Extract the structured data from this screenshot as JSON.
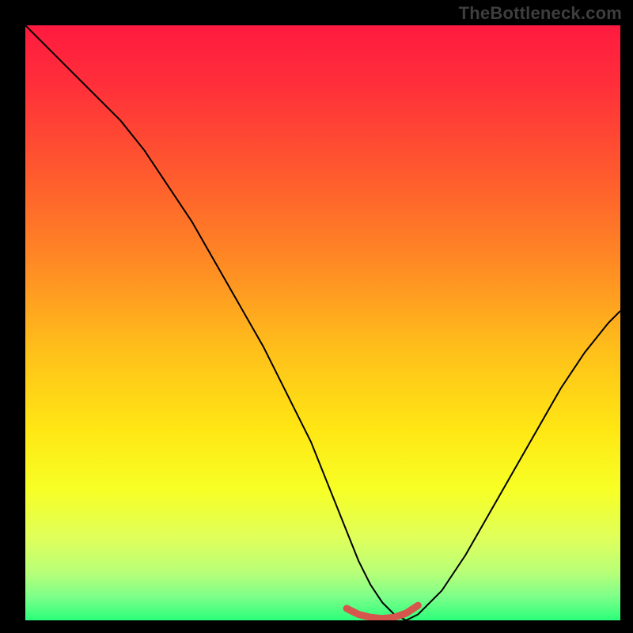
{
  "watermark": "TheBottleneck.com",
  "chart_data": {
    "type": "line",
    "title": "",
    "xlabel": "",
    "ylabel": "",
    "xlim": [
      0,
      100
    ],
    "ylim": [
      0,
      100
    ],
    "series": [
      {
        "name": "bottleneck-curve",
        "x": [
          0,
          4,
          8,
          12,
          16,
          20,
          24,
          28,
          32,
          36,
          40,
          44,
          48,
          52,
          54,
          56,
          58,
          60,
          62,
          64,
          66,
          70,
          74,
          78,
          82,
          86,
          90,
          94,
          98,
          100
        ],
        "values": [
          100,
          96,
          92,
          88,
          84,
          79,
          73,
          67,
          60,
          53,
          46,
          38,
          30,
          20,
          15,
          10,
          6,
          3,
          1,
          0,
          1,
          5,
          11,
          18,
          25,
          32,
          39,
          45,
          50,
          52
        ]
      },
      {
        "name": "optimum-highlight",
        "x": [
          54,
          56,
          58,
          60,
          62,
          64,
          66
        ],
        "values": [
          2,
          1,
          0.5,
          0.3,
          0.5,
          1.2,
          2.5
        ]
      }
    ],
    "background_gradient": {
      "stops": [
        {
          "offset": 0.0,
          "color": "#ff1a3f"
        },
        {
          "offset": 0.1,
          "color": "#ff2f3a"
        },
        {
          "offset": 0.25,
          "color": "#ff5a2e"
        },
        {
          "offset": 0.4,
          "color": "#ff8a24"
        },
        {
          "offset": 0.55,
          "color": "#ffc11a"
        },
        {
          "offset": 0.68,
          "color": "#ffe714"
        },
        {
          "offset": 0.78,
          "color": "#f7ff25"
        },
        {
          "offset": 0.86,
          "color": "#e0ff5a"
        },
        {
          "offset": 0.92,
          "color": "#b8ff78"
        },
        {
          "offset": 0.96,
          "color": "#7dff8a"
        },
        {
          "offset": 1.0,
          "color": "#2bff7a"
        }
      ]
    },
    "highlight_color": "#d6554d",
    "curve_color": "#000000"
  }
}
